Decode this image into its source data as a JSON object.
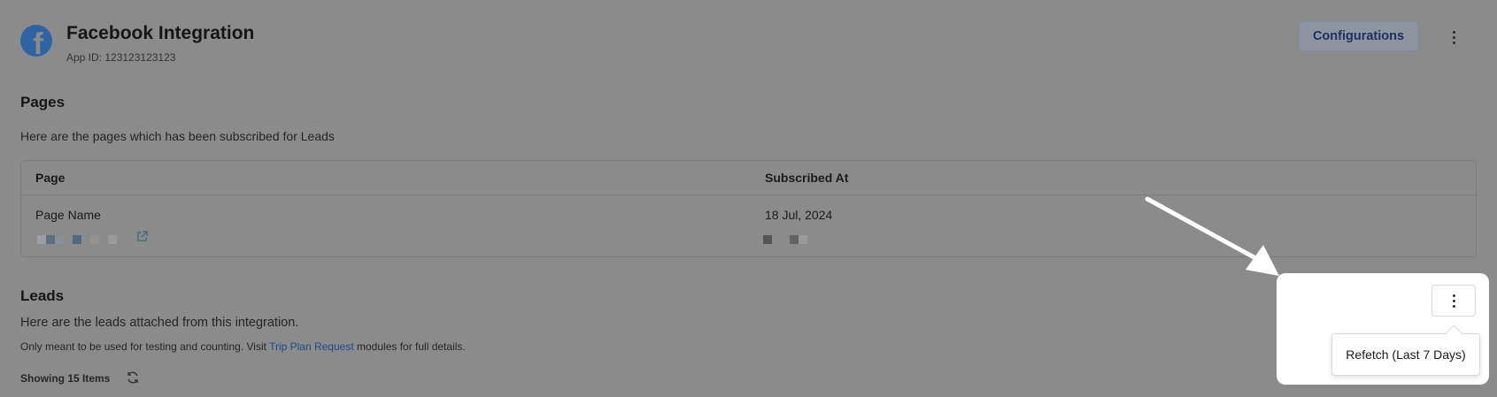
{
  "header": {
    "title": "Facebook Integration",
    "app_id": "App ID: 123123123123",
    "configurations_label": "Configurations",
    "logo_icon": "facebook-icon",
    "more_icon": "vertical-dots-icon"
  },
  "pages": {
    "heading": "Pages",
    "description": "Here are the pages which has been subscribed for Leads",
    "columns": [
      "Page",
      "Subscribed At"
    ],
    "rows": [
      {
        "page": "Page Name",
        "subscribed_at": "18 Jul, 2024"
      }
    ]
  },
  "leads": {
    "heading": "Leads",
    "description": "Here are the leads attached from this integration.",
    "note_prefix": "Only meant to be used for testing and counting. Visit ",
    "note_link": "Trip Plan Request",
    "note_suffix": " modules for full details.",
    "showing": "Showing 15 Items"
  },
  "menu": {
    "items": [
      "Refetch (Last 7 Days)"
    ]
  },
  "colors": {
    "overlay_bg": "#8b8b8b",
    "brand_blue": "#1e3261",
    "link": "#1f4a8a",
    "facebook": "#2f63a4"
  }
}
